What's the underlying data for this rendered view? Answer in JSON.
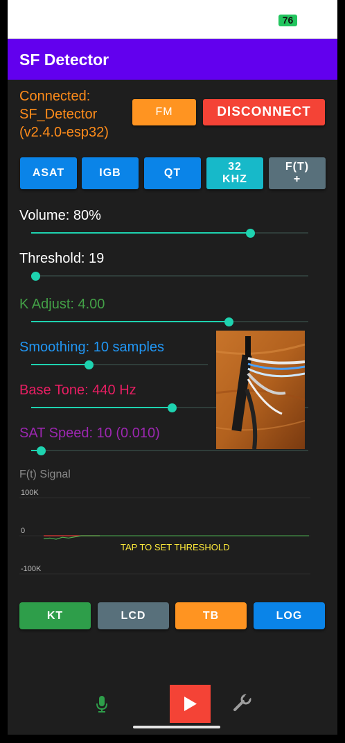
{
  "status_bar": {
    "battery": "76"
  },
  "app_bar": {
    "title": "SF Detector"
  },
  "connection": {
    "lines": [
      "Connected:",
      "SF_Detector",
      "(v2.4.0-esp32)"
    ],
    "fm_label": "FM",
    "disconnect_label": "DISCONNECT"
  },
  "mode_buttons": [
    {
      "label": "ASAT",
      "color": "#0a84e8"
    },
    {
      "label": "IGB",
      "color": "#0a84e8"
    },
    {
      "label": "QT",
      "color": "#0a84e8"
    },
    {
      "label": "32\nKHZ",
      "color": "#17b9c9"
    },
    {
      "label": "F(T)\n+",
      "color": "#58707b"
    }
  ],
  "sliders": [
    {
      "label": "Volume: 80%",
      "color": "#ffffff",
      "value": 0.8
    },
    {
      "label": "Threshold: 19",
      "color": "#ffffff",
      "value": 0.0
    },
    {
      "label": "K Adjust: 4.00",
      "color": "#43a047",
      "value": 0.72
    },
    {
      "label": "Smoothing: 10 samples",
      "color": "#2196f3",
      "value": 0.32
    },
    {
      "label": "Base Tone: 440 Hz",
      "color": "#e91e63",
      "value": 0.51
    },
    {
      "label": "SAT Speed: 10 (0.010)",
      "color": "#9c27b0",
      "value": 0.02
    }
  ],
  "signal_chart": {
    "title": "F(t) Signal",
    "ticks": [
      "100K",
      "0",
      "-100K"
    ],
    "tap_hint": "TAP TO SET THRESHOLD"
  },
  "chart_data": {
    "type": "line",
    "title": "F(t) Signal",
    "ylim": [
      -100000,
      100000
    ],
    "yticks": [
      "100K",
      "0",
      "-100K"
    ],
    "series": [
      {
        "color": "#e53935",
        "values": [
          0,
          0,
          0,
          0,
          0,
          0,
          0,
          0,
          0,
          0
        ]
      },
      {
        "color": "#4caf50",
        "values": [
          -8000,
          -6000,
          -9000,
          -4000,
          -6000,
          -3000,
          0,
          0,
          0,
          0
        ]
      }
    ],
    "annotation": "TAP TO SET THRESHOLD"
  },
  "bottom_buttons": [
    {
      "label": "KT",
      "color": "#2e9e4a"
    },
    {
      "label": "LCD",
      "color": "#58707b"
    },
    {
      "label": "TB",
      "color": "#ff9421"
    },
    {
      "label": "LOG",
      "color": "#0a84e8"
    }
  ],
  "bottom_nav": {
    "icons": [
      "mic-icon",
      "play-icon",
      "wrench-icon"
    ]
  }
}
